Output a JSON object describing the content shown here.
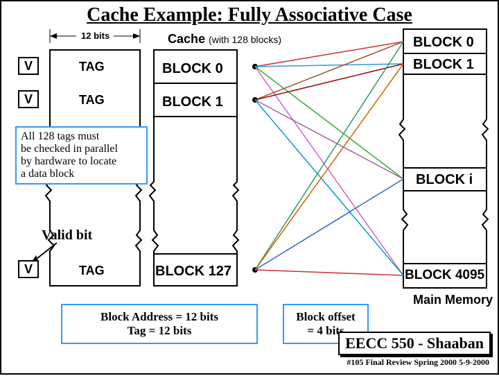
{
  "title": "Cache Example: Fully Associative Case",
  "bits_label": "12 bits",
  "cache_label_prefix": "Cache",
  "cache_label_suffix": "(with 128 blocks)",
  "v_label": "V",
  "tag_label": "TAG",
  "cache_blocks": {
    "b0": "BLOCK 0",
    "b1": "BLOCK 1",
    "b127": "BLOCK 127"
  },
  "mem_blocks": {
    "b0": "BLOCK 0",
    "b1": "BLOCK 1",
    "bi": "BLOCK i",
    "b4095": "BLOCK 4095"
  },
  "note": {
    "l1": "All 128 tags must",
    "l2": "be checked in parallel",
    "l3": "by hardware to locate",
    "l4": "a data block"
  },
  "valid_bit": "Valid bit",
  "block_addr": "Block Address  =  12 bits",
  "tag_bits": "Tag  =  12 bits",
  "block_offset_l1": "Block offset",
  "block_offset_l2": "=  4 bits",
  "main_memory": "Main Memory",
  "footer_course": "EECC 550 - Shaaban",
  "footer_line": "#105   Final Review   Spring 2000    5-9-2000"
}
